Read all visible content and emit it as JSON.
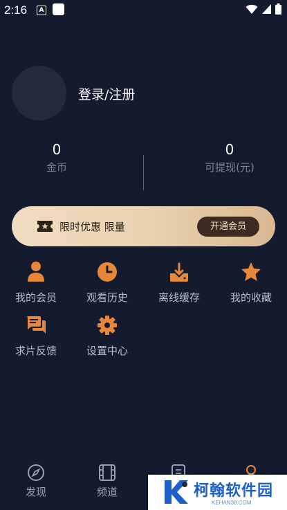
{
  "status_bar": {
    "time": "2:16",
    "a_icon": "A"
  },
  "profile": {
    "login_label": "登录/注册"
  },
  "stats": [
    {
      "value": "0",
      "label": "金币"
    },
    {
      "value": "0",
      "label": "可提现(元)"
    }
  ],
  "vip": {
    "text": "限时优惠 限量",
    "button": "开通会员",
    "icon": "ticket-icon"
  },
  "menu": [
    {
      "label": "我的会员",
      "icon": "user-icon"
    },
    {
      "label": "观看历史",
      "icon": "clock-icon"
    },
    {
      "label": "离线缓存",
      "icon": "download-icon"
    },
    {
      "label": "我的收藏",
      "icon": "star-icon"
    },
    {
      "label": "求片反馈",
      "icon": "chat-icon"
    },
    {
      "label": "设置中心",
      "icon": "gear-icon"
    }
  ],
  "bottom_nav": [
    {
      "label": "发现",
      "icon": "compass-icon"
    },
    {
      "label": "频道",
      "icon": "film-icon"
    },
    {
      "label": "",
      "icon": "list-icon"
    },
    {
      "label": "",
      "icon": "profile-icon",
      "active": true
    }
  ],
  "watermark": {
    "title": "柯翰软件园",
    "sub": "KEHAN38.COM"
  },
  "colors": {
    "background": "#141b2e",
    "accent": "#e8863a",
    "vip_button": "#3b2b22"
  }
}
